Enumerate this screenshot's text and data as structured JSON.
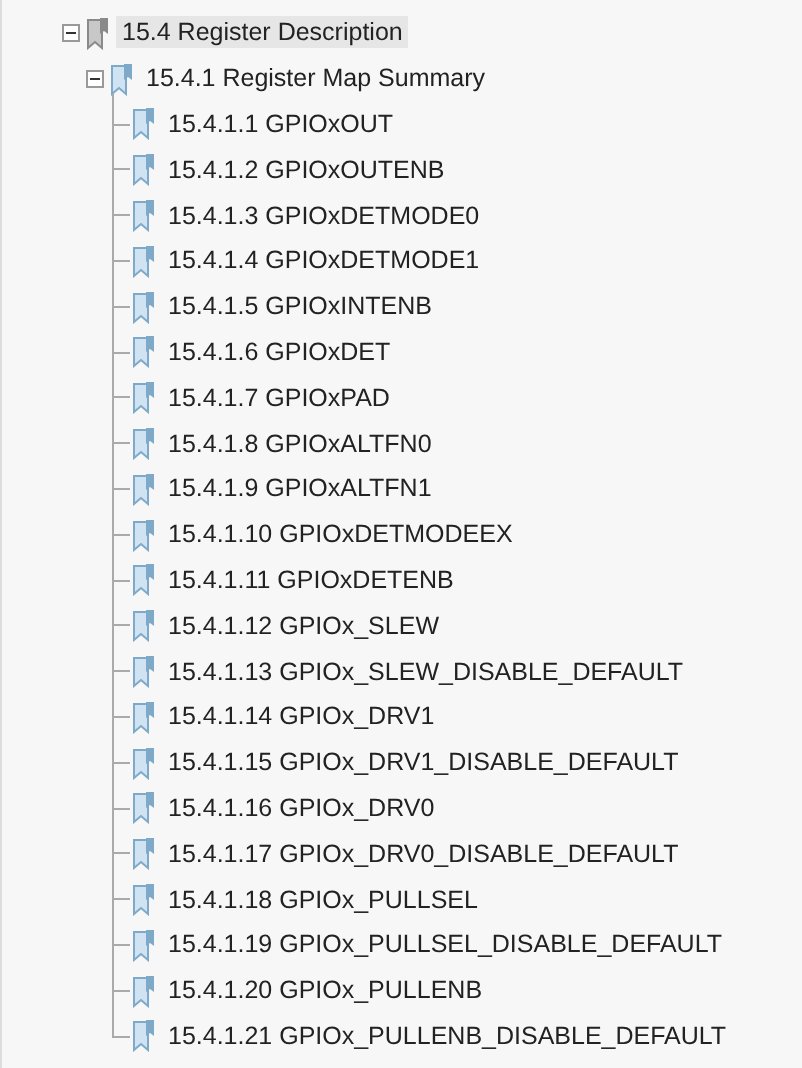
{
  "bookmarks": [
    {
      "label": "15.4 Register Description",
      "selected": true,
      "expanded": true,
      "children": [
        {
          "label": "15.4.1 Register Map Summary",
          "selected": false,
          "expanded": true,
          "children": [
            {
              "label": "15.4.1.1 GPIOxOUT",
              "selected": false
            },
            {
              "label": "15.4.1.2 GPIOxOUTENB",
              "selected": false
            },
            {
              "label": "15.4.1.3 GPIOxDETMODE0",
              "selected": false
            },
            {
              "label": "15.4.1.4 GPIOxDETMODE1",
              "selected": false
            },
            {
              "label": "15.4.1.5 GPIOxINTENB",
              "selected": false
            },
            {
              "label": "15.4.1.6 GPIOxDET",
              "selected": false
            },
            {
              "label": "15.4.1.7 GPIOxPAD",
              "selected": false
            },
            {
              "label": "15.4.1.8 GPIOxALTFN0",
              "selected": false
            },
            {
              "label": "15.4.1.9 GPIOxALTFN1",
              "selected": false
            },
            {
              "label": "15.4.1.10 GPIOxDETMODEEX",
              "selected": false
            },
            {
              "label": "15.4.1.11 GPIOxDETENB",
              "selected": false
            },
            {
              "label": "15.4.1.12 GPIOx_SLEW",
              "selected": false
            },
            {
              "label": "15.4.1.13 GPIOx_SLEW_DISABLE_DEFAULT",
              "selected": false
            },
            {
              "label": "15.4.1.14 GPIOx_DRV1",
              "selected": false
            },
            {
              "label": "15.4.1.15 GPIOx_DRV1_DISABLE_DEFAULT",
              "selected": false
            },
            {
              "label": "15.4.1.16 GPIOx_DRV0",
              "selected": false
            },
            {
              "label": "15.4.1.17 GPIOx_DRV0_DISABLE_DEFAULT",
              "selected": false
            },
            {
              "label": "15.4.1.18 GPIOx_PULLSEL",
              "selected": false
            },
            {
              "label": "15.4.1.19 GPIOx_PULLSEL_DISABLE_DEFAULT",
              "selected": false
            },
            {
              "label": "15.4.1.20 GPIOx_PULLENB",
              "selected": false
            },
            {
              "label": "15.4.1.21 GPIOx_PULLENB_DISABLE_DEFAULT",
              "selected": false
            }
          ]
        }
      ]
    }
  ]
}
